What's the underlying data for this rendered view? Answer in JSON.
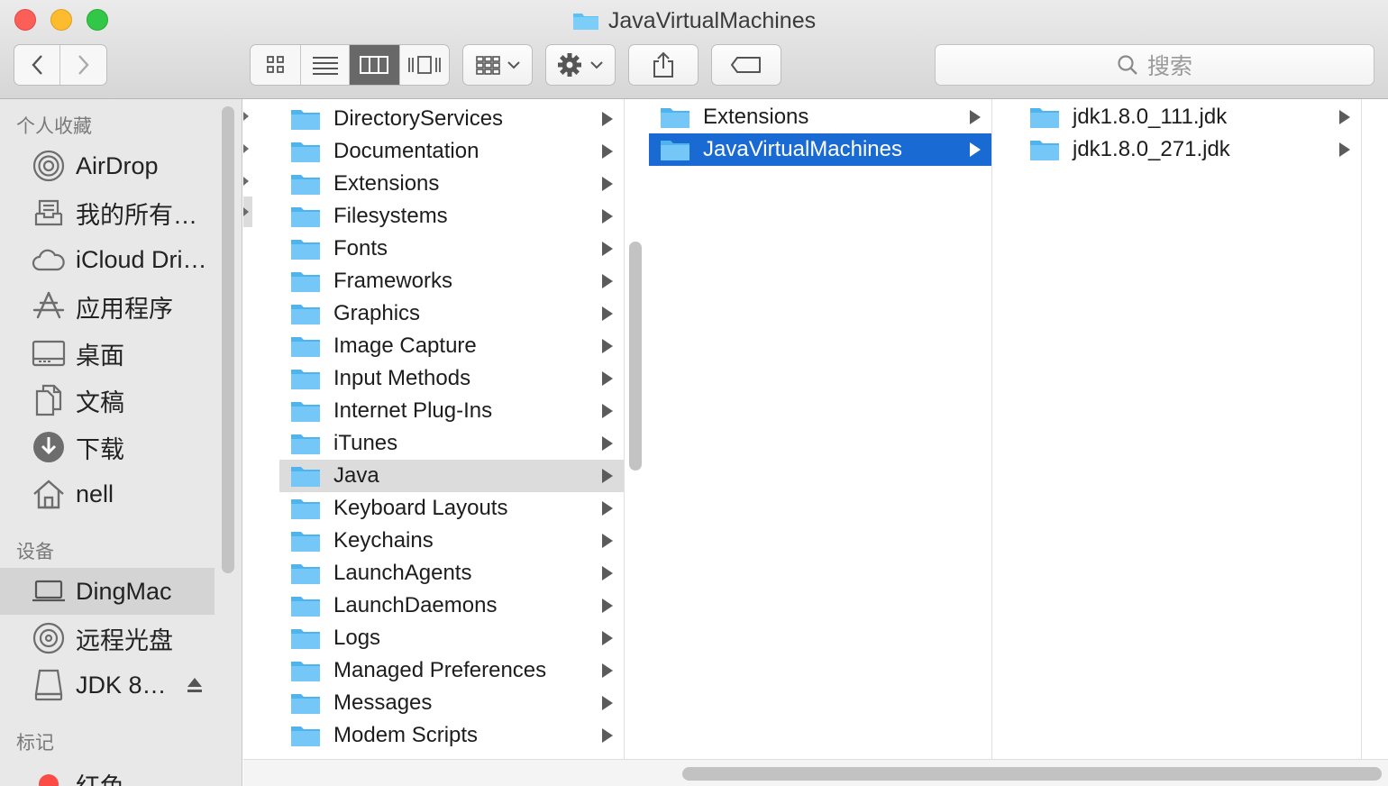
{
  "window": {
    "title": "JavaVirtualMachines"
  },
  "search": {
    "placeholder": "搜索"
  },
  "sidebar": {
    "favorites_header": "个人收藏",
    "favorites": [
      {
        "label": "AirDrop",
        "icon": "airdrop-icon"
      },
      {
        "label": "我的所有…",
        "icon": "all-files-icon"
      },
      {
        "label": "iCloud Dri…",
        "icon": "cloud-icon"
      },
      {
        "label": "应用程序",
        "icon": "applications-icon"
      },
      {
        "label": "桌面",
        "icon": "desktop-icon"
      },
      {
        "label": "文稿",
        "icon": "documents-icon"
      },
      {
        "label": "下载",
        "icon": "download-icon"
      },
      {
        "label": "nell",
        "icon": "home-icon"
      }
    ],
    "devices_header": "设备",
    "devices": [
      {
        "label": "DingMac",
        "icon": "laptop-icon",
        "selected": true
      },
      {
        "label": "远程光盘",
        "icon": "disc-icon"
      },
      {
        "label": "JDK 8…",
        "icon": "drive-icon"
      }
    ],
    "tags_header": "标记",
    "tags": [
      {
        "label": "红色",
        "color": "#fc4b45"
      }
    ]
  },
  "columns": {
    "library": [
      "DirectoryServices",
      "Documentation",
      "Extensions",
      "Filesystems",
      "Fonts",
      "Frameworks",
      "Graphics",
      "Image Capture",
      "Input Methods",
      "Internet Plug-Ins",
      "iTunes",
      "Java",
      "Keyboard Layouts",
      "Keychains",
      "LaunchAgents",
      "LaunchDaemons",
      "Logs",
      "Managed Preferences",
      "Messages",
      "Modem Scripts"
    ],
    "library_selected": "Java",
    "java": [
      "Extensions",
      "JavaVirtualMachines"
    ],
    "java_selected": "JavaVirtualMachines",
    "jvms": [
      "jdk1.8.0_111.jdk",
      "jdk1.8.0_271.jdk"
    ]
  },
  "colors": {
    "selection": "#1a6ad4",
    "folder": "#5cc0f5",
    "inactive_selection": "#dcdcdc"
  }
}
